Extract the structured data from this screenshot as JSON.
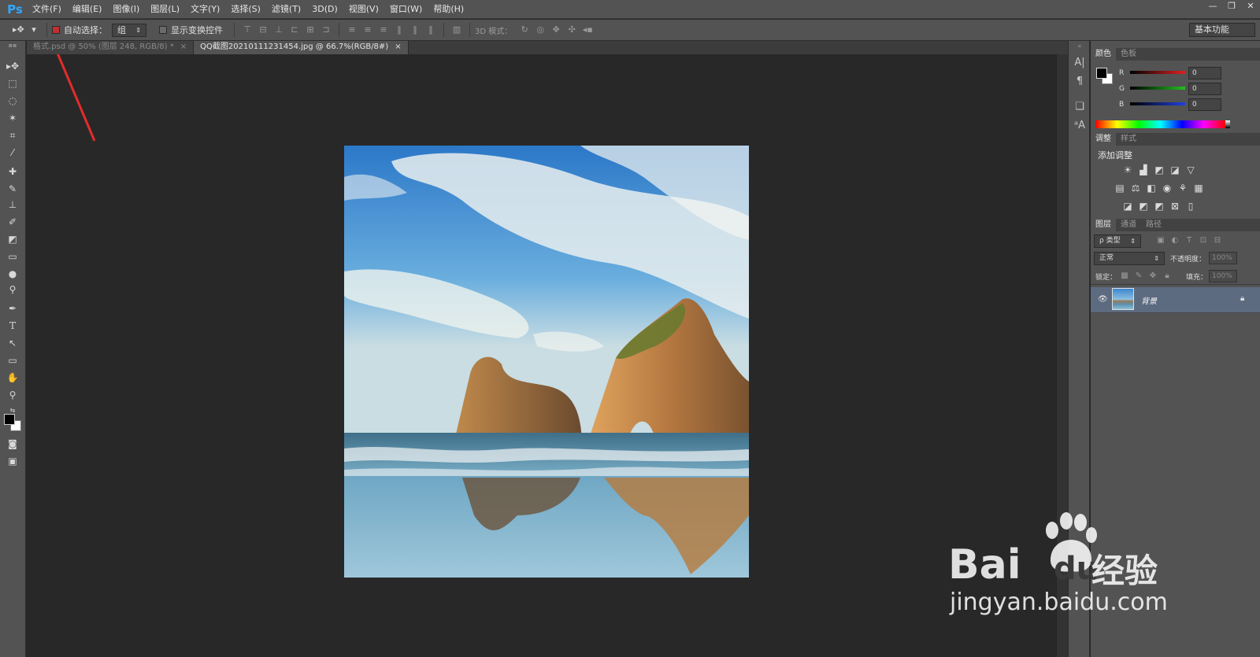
{
  "app": {
    "logo": "Ps"
  },
  "menu": [
    "文件(F)",
    "编辑(E)",
    "图像(I)",
    "图层(L)",
    "文字(Y)",
    "选择(S)",
    "滤镜(T)",
    "3D(D)",
    "视图(V)",
    "窗口(W)",
    "帮助(H)"
  ],
  "window_controls": {
    "minimize": "—",
    "restore": "❐",
    "close": "✕"
  },
  "options": {
    "auto_select_label": "自动选择：",
    "auto_select_value": "组",
    "show_transform_label": "显示变换控件",
    "mode_3d_label": "3D 模式：",
    "workspace": "基本功能"
  },
  "tabs": [
    {
      "label": "格式.psd @ 50% (图层 248, RGB/8) *",
      "close": "×",
      "active": false
    },
    {
      "label": "QQ截图20210111231454.jpg @ 66.7%(RGB/8#)",
      "close": "×",
      "active": true
    }
  ],
  "color_panel": {
    "tabs": [
      "颜色",
      "色板"
    ],
    "r_label": "R",
    "g_label": "G",
    "b_label": "B",
    "r": "0",
    "g": "0",
    "b": "0",
    "colors": {
      "r": "#e02020",
      "g": "#20c020",
      "b": "#2040e0"
    }
  },
  "adjustments_panel": {
    "tabs": [
      "调整",
      "样式"
    ],
    "title": "添加调整"
  },
  "layers_panel": {
    "tabs": [
      "图层",
      "通道",
      "路径"
    ],
    "filter_label": "ρ 类型",
    "blend_mode": "正常",
    "opacity_label": "不透明度：",
    "opacity_value": "100%",
    "lock_label": "锁定：",
    "fill_label": "填充：",
    "fill_value": "100%",
    "layers": [
      {
        "name": "背景",
        "visible": true,
        "locked": true
      }
    ]
  },
  "watermark": {
    "brand": "Bai",
    "brand2": "du",
    "suffix": "经验",
    "url": "jingyan.baidu.com"
  }
}
